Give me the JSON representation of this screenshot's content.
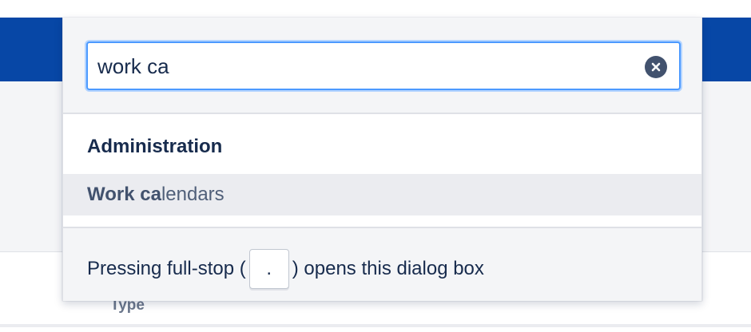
{
  "background": {
    "column_label": "Type"
  },
  "dialog": {
    "search": {
      "value": "work ca",
      "placeholder": ""
    },
    "clear_icon": "clear-circle-x-icon",
    "section": {
      "title": "Administration"
    },
    "results": [
      {
        "match": "Work ca",
        "rest": "lendars"
      }
    ],
    "footer": {
      "hint_before": "Pressing full-stop (",
      "key": ".",
      "hint_after": ") opens this dialog box"
    }
  },
  "colors": {
    "topbar": "#0747a6",
    "focus_ring": "#4c9aff",
    "highlight_row": "#ebecf0"
  }
}
